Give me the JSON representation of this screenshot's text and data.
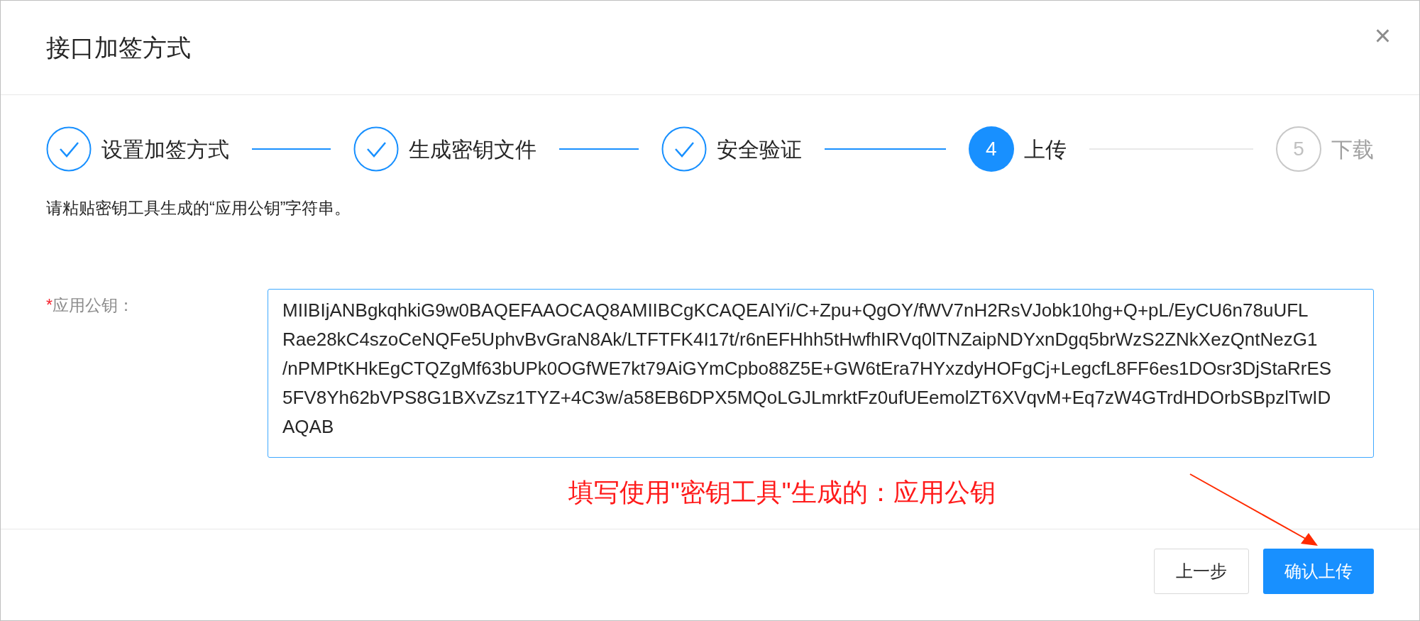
{
  "dialog": {
    "title": "接口加签方式",
    "close": "×"
  },
  "steps": [
    {
      "label": "设置加签方式",
      "done": true,
      "selected": false
    },
    {
      "label": "生成密钥文件",
      "done": true,
      "selected": false
    },
    {
      "label": "安全验证",
      "done": true,
      "selected": false
    },
    {
      "label": "上传",
      "number": "4",
      "done": false,
      "selected": true
    },
    {
      "label": "下载",
      "number": "5",
      "done": false,
      "selected": false
    }
  ],
  "instruction": "请粘贴密钥工具生成的“应用公钥”字符串。",
  "form": {
    "label": "应用公钥：",
    "required_mark": "*",
    "value": "MIIBIjANBgkqhkiG9w0BAQEFAAOCAQ8AMIIBCgKCAQEAlYi/C+Zpu+QgOY/fWV7nH2RsVJobk10hg+Q+pL/EyCU6n78uUFL\nRae28kC4szoCeNQFe5UphvBvGraN8Ak/LTFTFK4I17t/r6nEFHhh5tHwfhIRVq0lTNZaipNDYxnDgq5brWzS2ZNkXezQntNezG1\n/nPMPtKHkEgCTQZgMf63bUPk0OGfWE7kt79AiGYmCpbo88Z5E+GW6tEra7HYxzdyHOFgCj+LegcfL8FF6es1DOsr3DjStaRrES\n5FV8Yh62bVPS8G1BXvZsz1TYZ+4C3w/a58EB6DPX5MQoLGJLmrktFz0ufUEemolZT6XVqvM+Eq7zW4GTrdHDOrbSBpzlTwID\nAQAB"
  },
  "annotation": "填写使用\"密钥工具\"生成的：应用公钥",
  "buttons": [
    {
      "label": "上一步",
      "kind": "default"
    },
    {
      "label": "确认上传",
      "kind": "primary"
    }
  ]
}
